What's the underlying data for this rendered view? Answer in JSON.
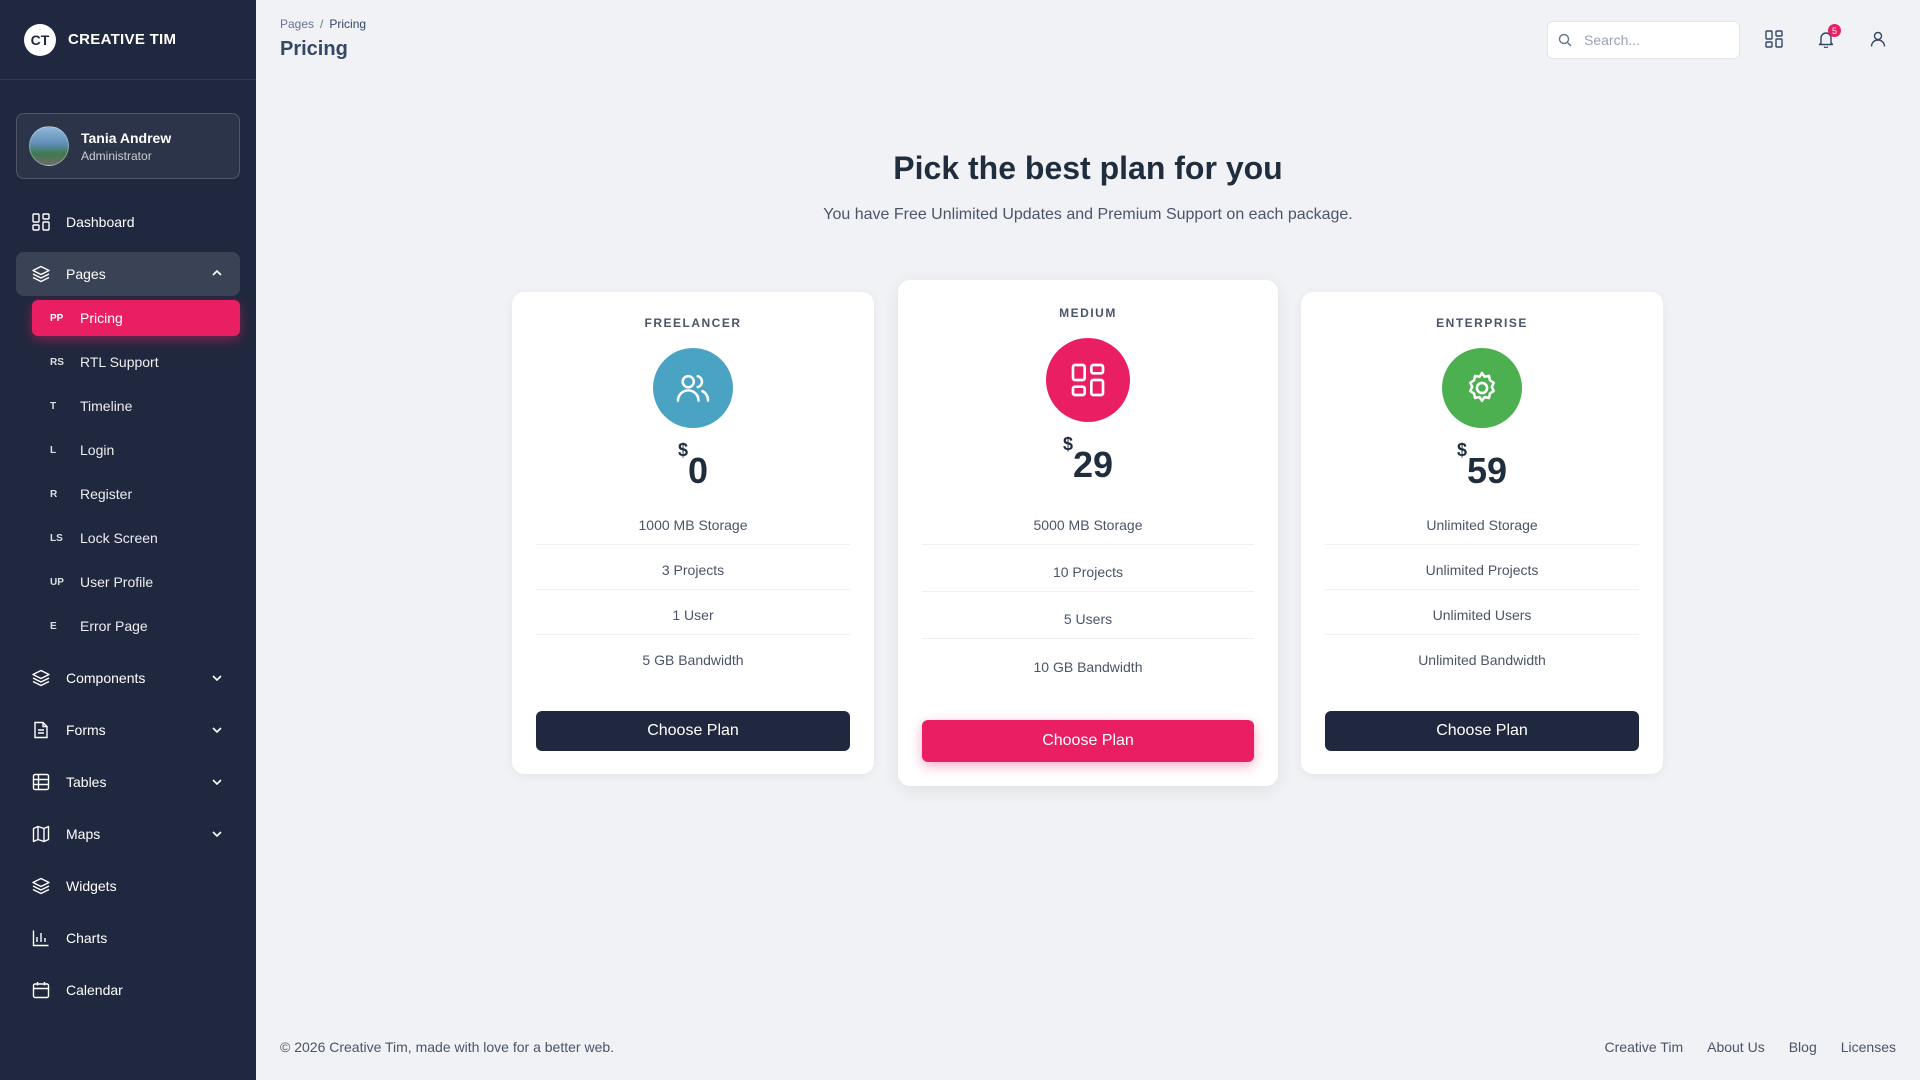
{
  "brand": {
    "logo_text": "CT",
    "name": "CREATIVE TIM"
  },
  "user": {
    "name": "Tania Andrew",
    "role": "Administrator"
  },
  "sidebar": {
    "dashboard": "Dashboard",
    "pages": "Pages",
    "sub_items": [
      {
        "abbr": "PP",
        "label": "Pricing"
      },
      {
        "abbr": "RS",
        "label": "RTL Support"
      },
      {
        "abbr": "T",
        "label": "Timeline"
      },
      {
        "abbr": "L",
        "label": "Login"
      },
      {
        "abbr": "R",
        "label": "Register"
      },
      {
        "abbr": "LS",
        "label": "Lock Screen"
      },
      {
        "abbr": "UP",
        "label": "User Profile"
      },
      {
        "abbr": "E",
        "label": "Error Page"
      }
    ],
    "components": "Components",
    "forms": "Forms",
    "tables": "Tables",
    "maps": "Maps",
    "widgets": "Widgets",
    "charts": "Charts",
    "calendar": "Calendar"
  },
  "header": {
    "breadcrumb_root": "Pages",
    "breadcrumb_sep": "/",
    "breadcrumb_current": "Pricing",
    "title": "Pricing",
    "search_placeholder": "Search...",
    "notification_count": "5"
  },
  "hero": {
    "title": "Pick the best plan for you",
    "subtitle": "You have Free Unlimited Updates and Premium Support on each package."
  },
  "plans": [
    {
      "label": "FREELANCER",
      "currency": "$",
      "price": "0",
      "icon": "users-icon",
      "color": "#4ba3c3",
      "features": [
        "1000 MB Storage",
        "3 Projects",
        "1 User",
        "5 GB Bandwidth"
      ],
      "button": "Choose Plan"
    },
    {
      "label": "MEDIUM",
      "currency": "$",
      "price": "29",
      "icon": "grid-icon",
      "color": "#e91e63",
      "features": [
        "5000 MB Storage",
        "10 Projects",
        "5 Users",
        "10 GB Bandwidth"
      ],
      "button": "Choose Plan"
    },
    {
      "label": "ENTERPRISE",
      "currency": "$",
      "price": "59",
      "icon": "gear-icon",
      "color": "#4caf50",
      "features": [
        "Unlimited Storage",
        "Unlimited Projects",
        "Unlimited Users",
        "Unlimited Bandwidth"
      ],
      "button": "Choose Plan"
    }
  ],
  "footer": {
    "copyright": "© 2026 Creative Tim, made with love for a better web.",
    "links": [
      "Creative Tim",
      "About Us",
      "Blog",
      "Licenses"
    ]
  }
}
